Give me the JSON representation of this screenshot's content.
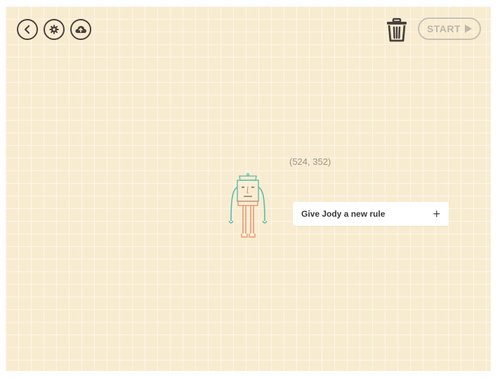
{
  "toolbar": {
    "back_icon": "chevron-left-icon",
    "settings_icon": "gear-icon",
    "upload_icon": "cloud-upload-icon",
    "trash_icon": "trash-icon",
    "start_label": "START",
    "start_icon": "play-triangle-icon"
  },
  "canvas": {
    "coordinate_readout": "(524, 352)",
    "character_name": "Jody",
    "character_icon": "robot-character-icon"
  },
  "rule_card": {
    "label": "Give Jody a new rule",
    "add_symbol": "+"
  },
  "colors": {
    "background": "#f8ecd0",
    "icon_dark": "#4a403c",
    "start_disabled": "#bdb6a8",
    "character_teal": "#5fb9ad",
    "character_orange": "#e0886a"
  }
}
